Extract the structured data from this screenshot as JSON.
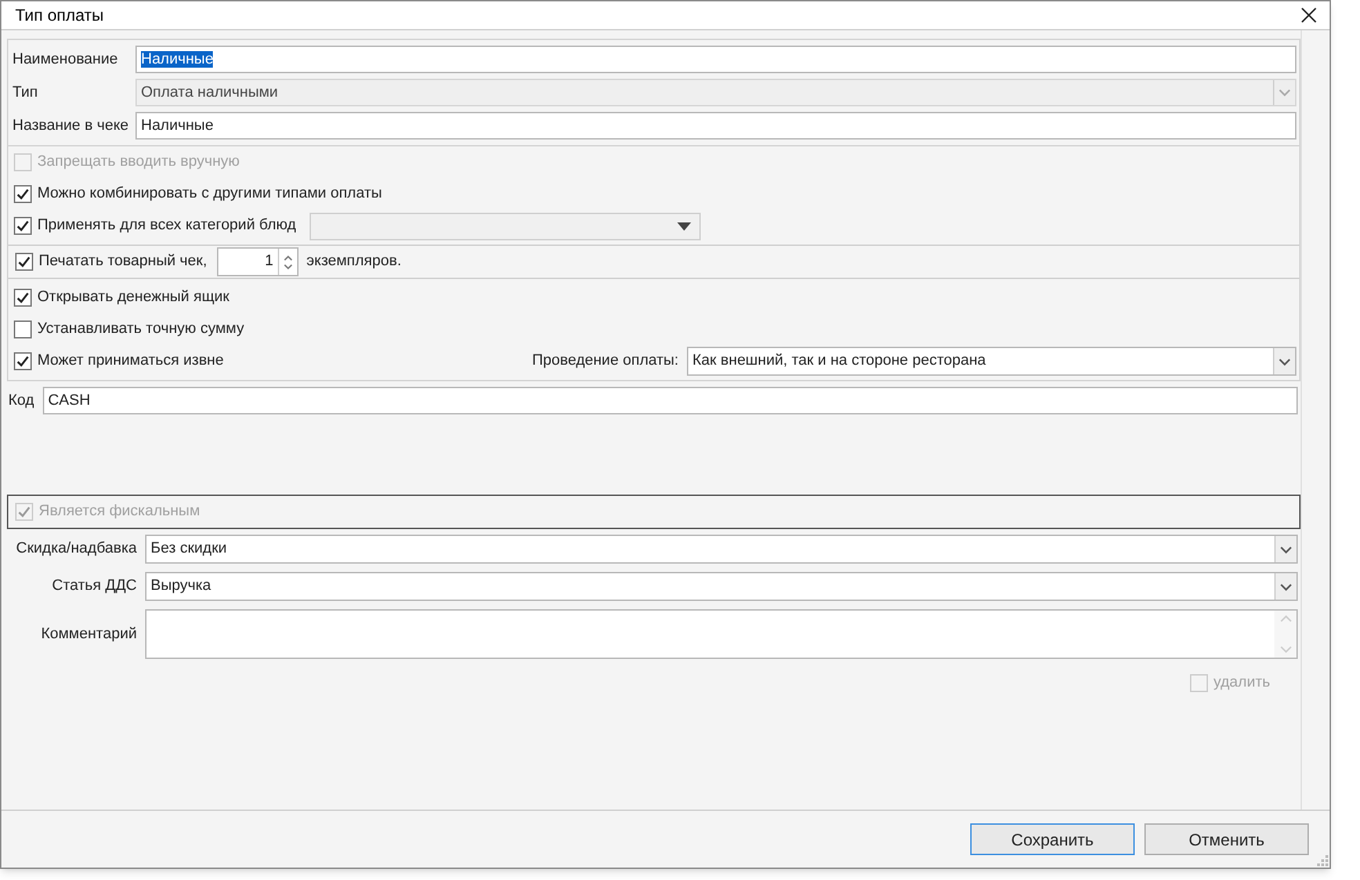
{
  "window": {
    "title": "Тип оплаты"
  },
  "main_fields": [
    {
      "kind": "text",
      "label": "Наименование",
      "value": "Наличные",
      "selected": true,
      "disabled": false
    },
    {
      "kind": "combo",
      "label": "Тип",
      "value": "Оплата наличными",
      "selected": false,
      "disabled": true
    },
    {
      "kind": "text",
      "label": "Название в чеке",
      "value": "Наличные",
      "selected": false,
      "disabled": false
    }
  ],
  "options": [
    {
      "kind": "checkbox",
      "label": "Запрещать вводить вручную",
      "checked": false,
      "disabled": true
    },
    {
      "kind": "checkbox",
      "label": "Можно комбинировать с другими типами оплаты",
      "checked": true,
      "disabled": false
    },
    {
      "kind": "checkbox_combo",
      "label": "Применять для всех категорий блюд",
      "checked": true,
      "disabled": false
    },
    {
      "kind": "checkbox_spin",
      "label": "Печатать товарный чек,",
      "checked": true,
      "disabled": false,
      "value": "1",
      "suffix": "экземпляров."
    },
    {
      "kind": "checkbox",
      "label": "Открывать денежный ящик",
      "checked": true,
      "disabled": false
    },
    {
      "kind": "checkbox",
      "label": "Устанавливать точную сумму",
      "checked": false,
      "disabled": false
    },
    {
      "kind": "checkbox_select",
      "label": "Может приниматься извне",
      "checked": true,
      "disabled": false,
      "select_label": "Проведение оплаты:",
      "select_value": "Как внешний, так и на стороне ресторана"
    }
  ],
  "code": {
    "label": "Код",
    "value": "CASH"
  },
  "fiscal": {
    "label": "Является фискальным",
    "checked": true,
    "disabled": true
  },
  "lower_fields": [
    {
      "kind": "combo",
      "label": "Скидка/надбавка",
      "value": "Без скидки"
    },
    {
      "kind": "combo",
      "label": "Статья ДДС",
      "value": "Выручка"
    },
    {
      "kind": "memo",
      "label": "Комментарий"
    }
  ],
  "delete_option": {
    "label": "удалить",
    "checked": false,
    "disabled": true
  },
  "buttons": [
    {
      "label": "Сохранить",
      "selected": true
    },
    {
      "label": "Отменить",
      "selected": false
    }
  ]
}
